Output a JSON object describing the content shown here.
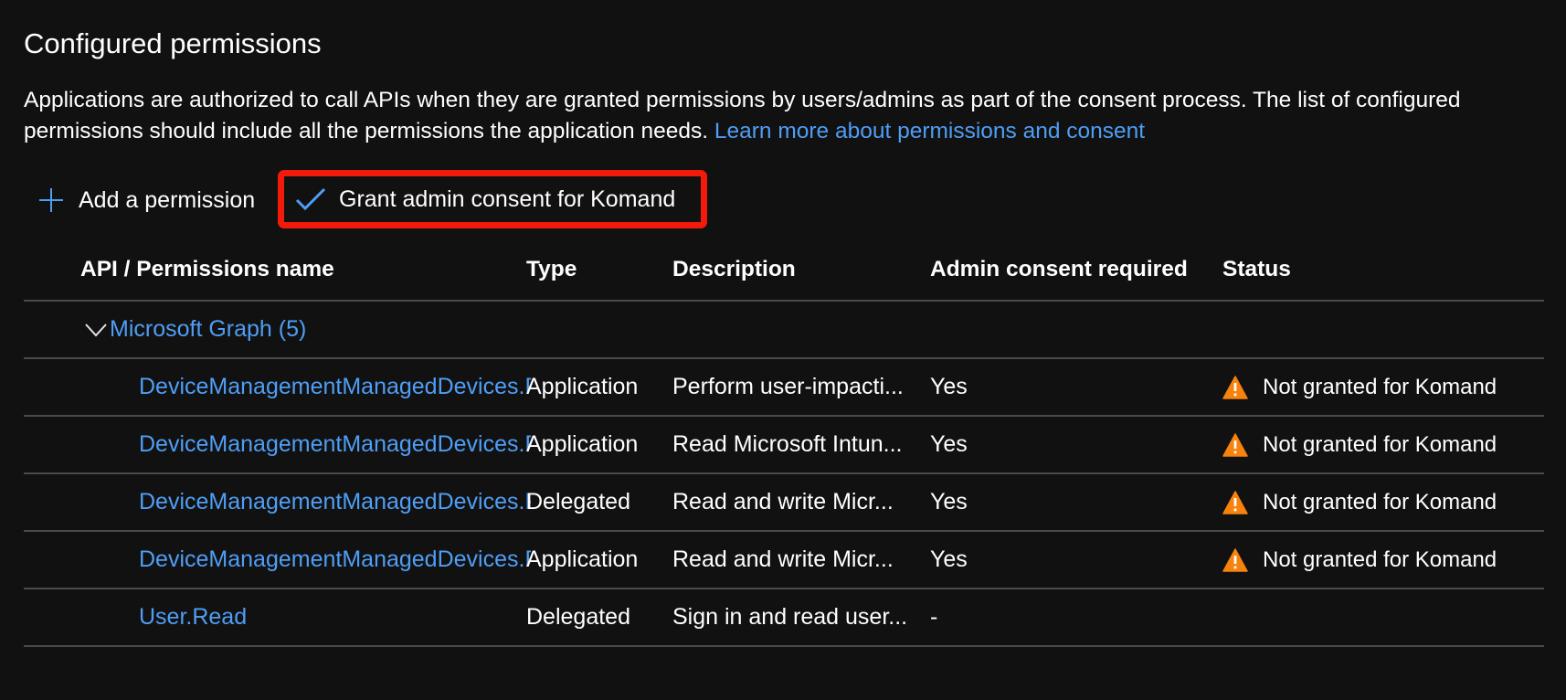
{
  "page": {
    "title": "Configured permissions",
    "description": "Applications are authorized to call APIs when they are granted permissions by users/admins as part of the consent process. The list of configured permissions should include all the permissions the application needs.",
    "learn_more_link": "Learn more about permissions and consent"
  },
  "toolbar": {
    "add_label": "Add a permission",
    "grant_label": "Grant admin consent for Komand"
  },
  "table": {
    "columns": [
      "API / Permissions name",
      "Type",
      "Description",
      "Admin consent required",
      "Status"
    ],
    "group": {
      "label": "Microsoft Graph (5)"
    },
    "rows": [
      {
        "name": "DeviceManagementManagedDevices.P",
        "type": "Application",
        "description": "Perform user-impacti...",
        "admin": "Yes",
        "status": "Not granted for Komand"
      },
      {
        "name": "DeviceManagementManagedDevices.P",
        "type": "Application",
        "description": "Read Microsoft Intun...",
        "admin": "Yes",
        "status": "Not granted for Komand"
      },
      {
        "name": "DeviceManagementManagedDevices.P",
        "type": "Delegated",
        "description": "Read and write Micr...",
        "admin": "Yes",
        "status": "Not granted for Komand"
      },
      {
        "name": "DeviceManagementManagedDevices.P",
        "type": "Application",
        "description": "Read and write Micr...",
        "admin": "Yes",
        "status": "Not granted for Komand"
      },
      {
        "name": "User.Read",
        "type": "Delegated",
        "description": "Sign in and read user...",
        "admin": "-",
        "status": ""
      }
    ]
  },
  "colors": {
    "background": "#111111",
    "link": "#4f9ef5",
    "highlight": "#f21a0a",
    "warning": "#f7820e"
  },
  "icons": {
    "add": "plus-icon",
    "grant": "check-icon",
    "group": "chevron-down-icon",
    "warning": "warning-triangle-icon"
  }
}
